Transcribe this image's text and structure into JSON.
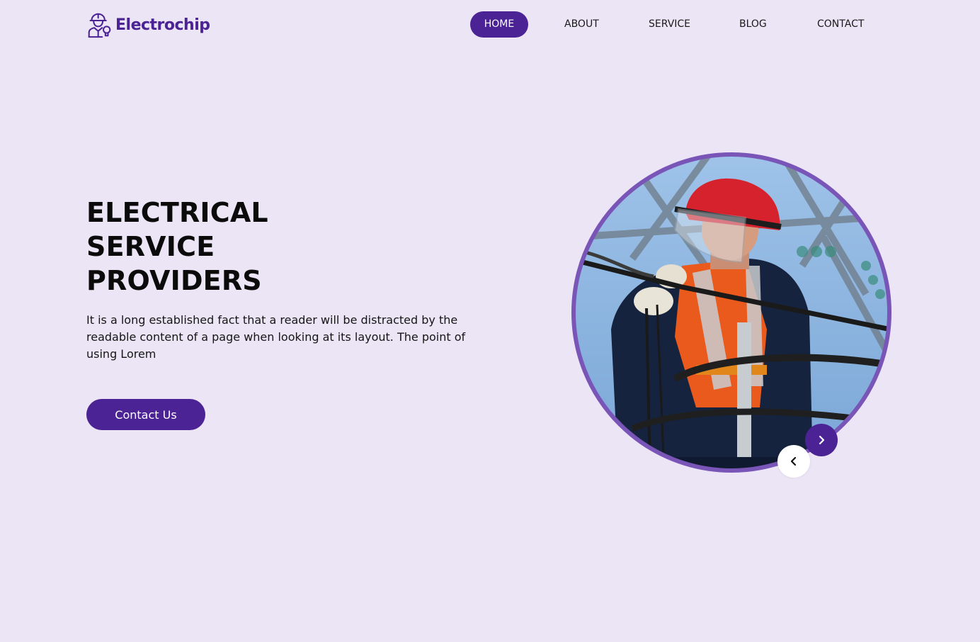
{
  "brand": {
    "name": "Electrochip",
    "logo_icon": "electrician-worker-icon",
    "color": "#4b2394"
  },
  "nav": {
    "items": [
      {
        "label": "HOME",
        "active": true
      },
      {
        "label": "ABOUT",
        "active": false
      },
      {
        "label": "SERVICE",
        "active": false
      },
      {
        "label": "BLOG",
        "active": false
      },
      {
        "label": "CONTACT",
        "active": false
      }
    ]
  },
  "hero": {
    "title_lines": [
      "ELECTRICAL",
      "SERVICE",
      "PROVIDERS"
    ],
    "description": "It is a long established fact that a reader will be distracted by the readable content of a page when looking at its layout. The point of using Lorem",
    "cta_label": "Contact Us",
    "image_subject": "lineman-on-power-pole-photo",
    "slider": {
      "prev_icon": "chevron-left-icon",
      "next_icon": "chevron-right-icon"
    }
  },
  "colors": {
    "background": "#ebe5f5",
    "accent": "#4b2394",
    "ring": "#7a55b8",
    "white": "#ffffff"
  }
}
